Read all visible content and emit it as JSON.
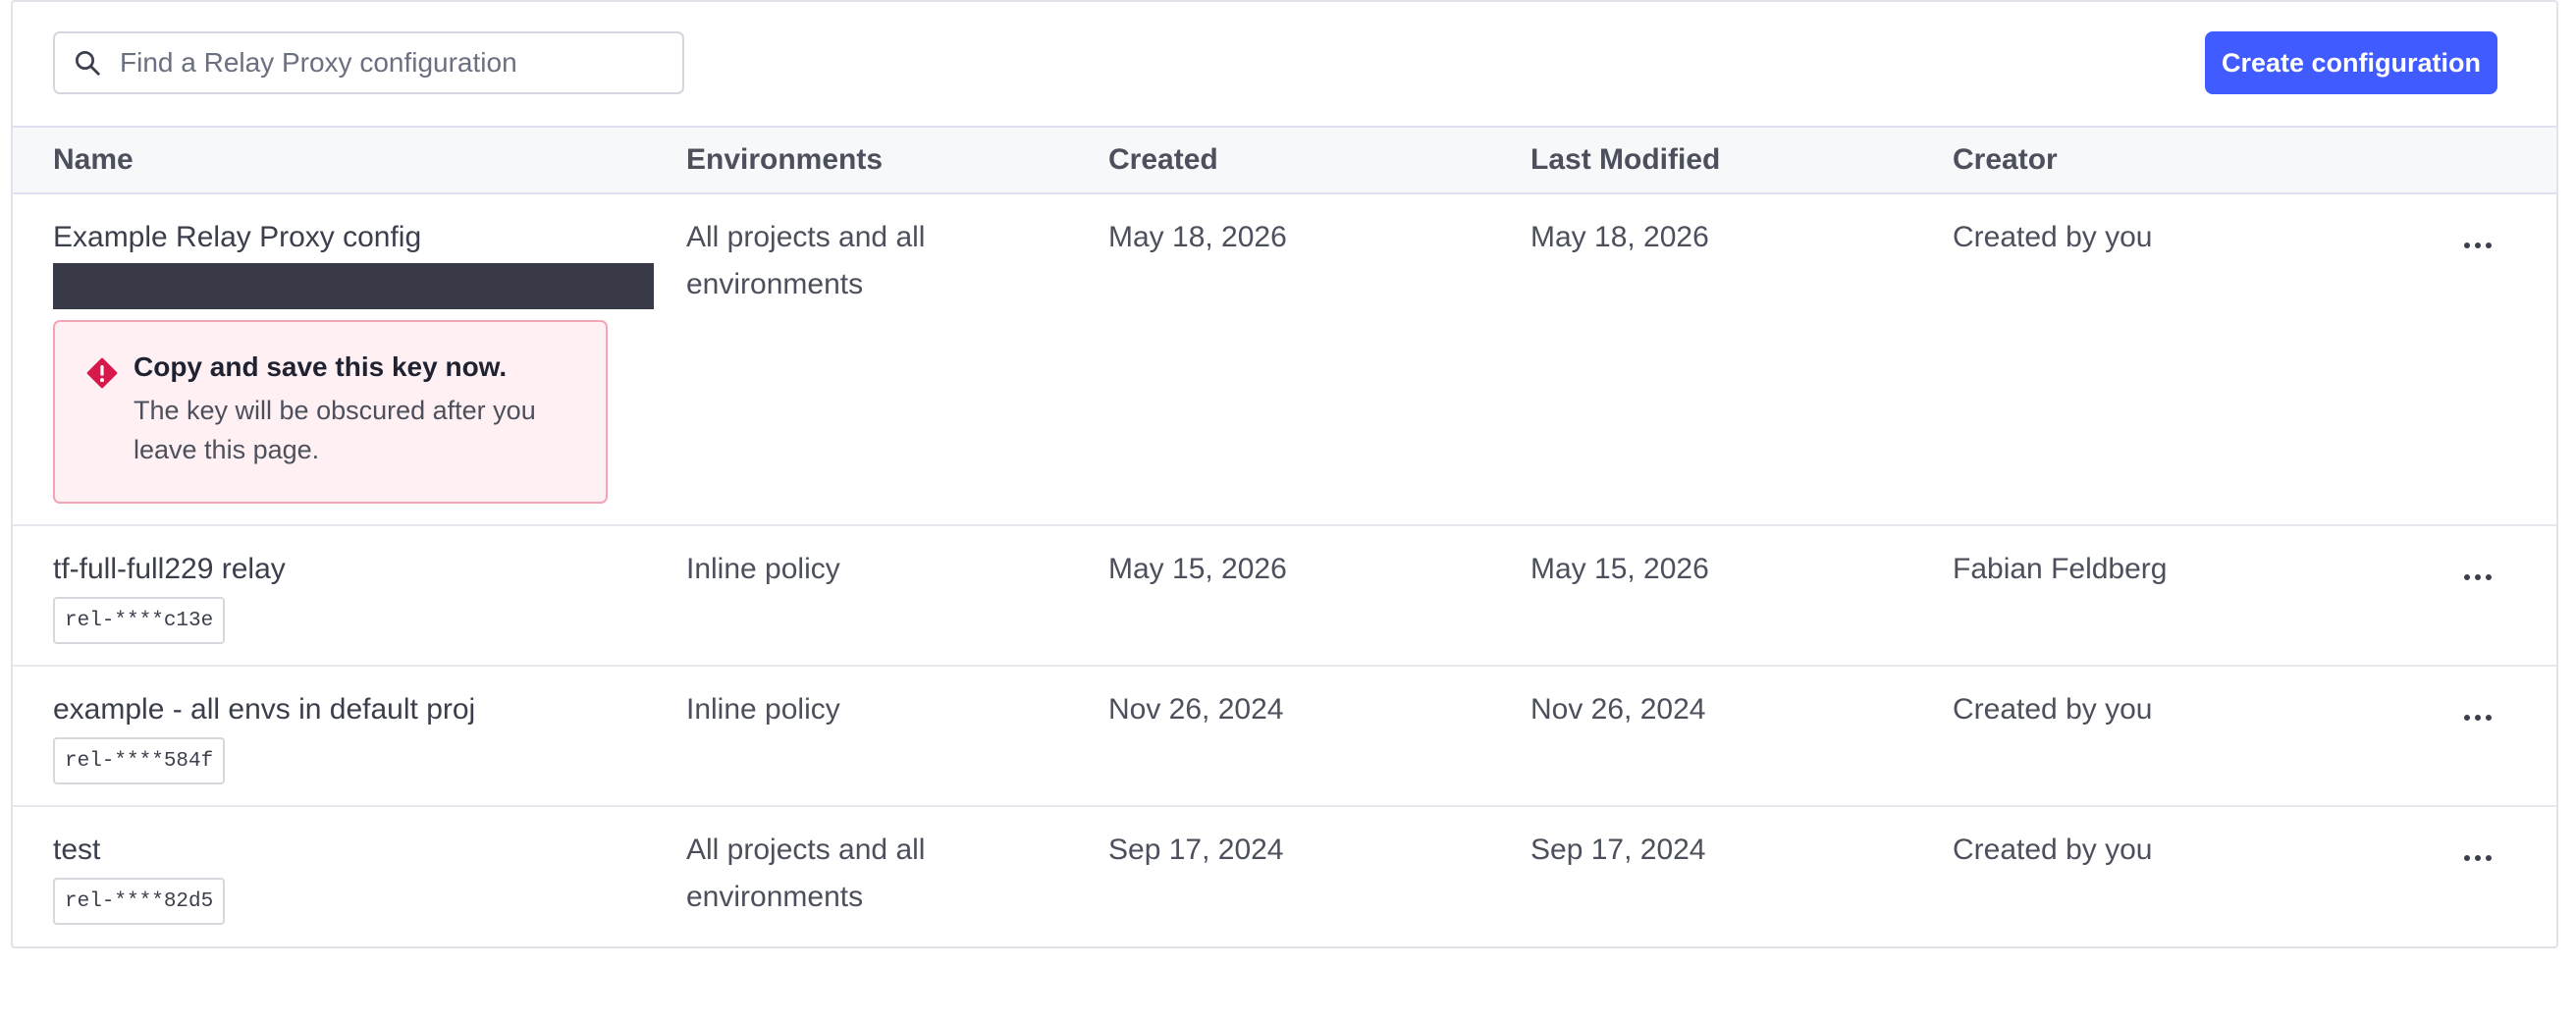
{
  "search": {
    "placeholder": "Find a Relay Proxy configuration",
    "icon": "search-icon"
  },
  "toolbar": {
    "create_label": "Create configuration",
    "accent_color": "#405bff"
  },
  "table": {
    "columns": [
      "Name",
      "Environments",
      "Created",
      "Last Modified",
      "Creator"
    ],
    "rows": [
      {
        "name": "Example Relay Proxy config",
        "environments": "All projects and all environments",
        "created": "May 18, 2026",
        "modified": "May 18, 2026",
        "creator": "Created by you",
        "alert": {
          "title": "Copy and save this key now.",
          "body": "The key will be obscured after you leave this page."
        }
      },
      {
        "name": "tf-full-full229 relay",
        "key": "rel-****c13e",
        "environments": "Inline policy",
        "created": "May 15, 2026",
        "modified": "May 15, 2026",
        "creator": "Fabian Feldberg"
      },
      {
        "name": "example - all envs in default proj",
        "key": "rel-****584f",
        "environments": "Inline policy",
        "created": "Nov 26, 2024",
        "modified": "Nov 26, 2024",
        "creator": "Created by you"
      },
      {
        "name": "test",
        "key": "rel-****82d5",
        "environments": "All projects and all environments",
        "created": "Sep 17, 2024",
        "modified": "Sep 17, 2024",
        "creator": "Created by you"
      }
    ]
  }
}
